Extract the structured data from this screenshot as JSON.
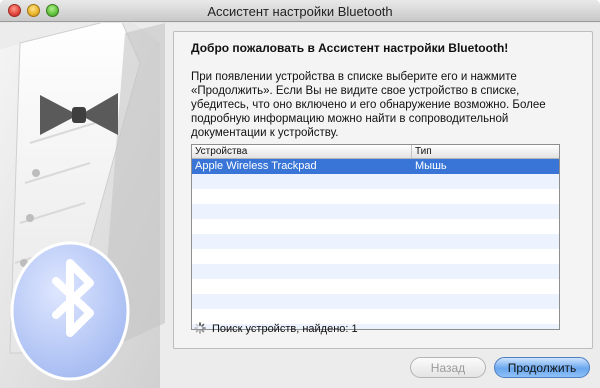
{
  "window": {
    "title": "Ассистент настройки Bluetooth"
  },
  "intro": {
    "heading": "Добро пожаловать в Ассистент настройки Bluetooth!",
    "description": "При появлении устройства в списке выберите его и нажмите «Продолжить». Если Вы не видите свое устройство в списке, убедитесь, что оно включено и его обнаружение возможно. Более подробную информацию можно найти в сопроводительной документации к устройству."
  },
  "devices": {
    "columns": [
      "Устройства",
      "Тип"
    ],
    "rows": [
      {
        "name": "Apple Wireless Trackpad",
        "type": "Мышь",
        "selected": true
      }
    ]
  },
  "status": {
    "text": "Поиск устройств, найдено: 1"
  },
  "buttons": {
    "back": "Назад",
    "continue": "Продолжить"
  },
  "colors": {
    "selection": "#3875d7",
    "bluetooth_badge": "#b9c9f7"
  }
}
